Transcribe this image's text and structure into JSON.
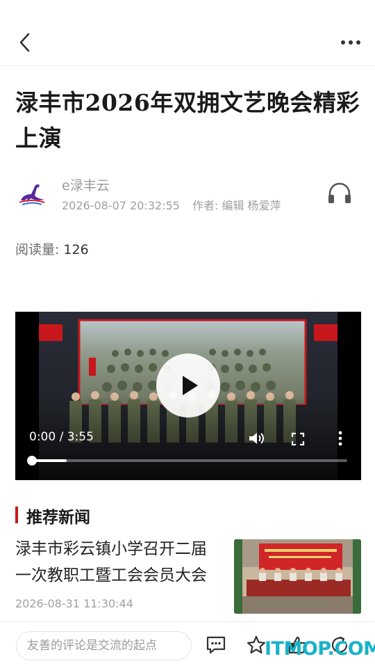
{
  "header": {
    "back_icon": "chevron-left-icon",
    "more_icon": "more-horizontal-icon"
  },
  "article": {
    "title_line1": "渌丰市2026年双拥文艺晚会精彩",
    "title_line2": "上演",
    "source": "e渌丰云",
    "datetime": "2026-08-07 20:32:55",
    "author_label": "作者:",
    "author": "编辑 杨爱萍",
    "listen_icon": "headphones-icon",
    "read_label": "阅读量:",
    "read_count": "126"
  },
  "video": {
    "time": "0:00 / 3:55",
    "progress_fraction": 0.0,
    "buffered_fraction": 0.11,
    "play_icon": "play-icon",
    "volume_icon": "volume-icon",
    "fullscreen_icon": "fullscreen-icon",
    "more_icon": "more-vertical-icon"
  },
  "recommend": {
    "section_title": "推荐新闻",
    "items": [
      {
        "title_line1": "渌丰市彩云镇小学召开二届",
        "title_line2": "一次教职工暨工会会员大会",
        "time": "2026-08-31 11:30:44"
      }
    ]
  },
  "bottom_bar": {
    "comment_placeholder": "友善的评论是交流的起点",
    "icons": [
      "comment-icon",
      "star-icon",
      "like-icon",
      "share-icon"
    ]
  },
  "watermark": "ITMOP.COM",
  "colors": {
    "accent_red": "#c8161d",
    "watermark": "#17b3c8"
  }
}
